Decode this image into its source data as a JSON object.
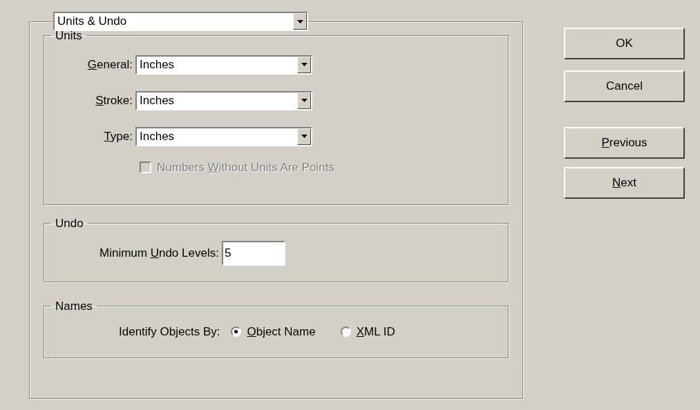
{
  "panel_select": {
    "value": "Units & Undo"
  },
  "units": {
    "title": "Units",
    "rows": [
      {
        "label": {
          "key": "G",
          "post": "eneral:"
        },
        "value": "Inches"
      },
      {
        "label": {
          "key": "S",
          "post": "troke:"
        },
        "value": "Inches"
      },
      {
        "label": {
          "key": "T",
          "post": "ype:"
        },
        "value": "Inches"
      }
    ],
    "checkbox": {
      "label": {
        "pre": "Numbers ",
        "key": "W",
        "post": "ithout Units Are Points"
      },
      "checked": false,
      "disabled": true
    }
  },
  "undo": {
    "title": "Undo",
    "label": {
      "pre": "Minimum ",
      "key": "U",
      "post": "ndo Levels:"
    },
    "value": "5"
  },
  "names": {
    "title": "Names",
    "label": "Identify Objects By:",
    "options": [
      {
        "label": {
          "key": "O",
          "post": "bject Name"
        },
        "selected": true
      },
      {
        "label": {
          "key": "X",
          "post": "ML ID"
        },
        "selected": false
      }
    ]
  },
  "buttons": [
    {
      "label": {
        "post": "OK"
      }
    },
    {
      "label": {
        "post": "Cancel"
      }
    },
    {
      "label": {
        "key": "P",
        "post": "revious"
      }
    },
    {
      "label": {
        "key": "N",
        "post": "ext"
      }
    }
  ]
}
